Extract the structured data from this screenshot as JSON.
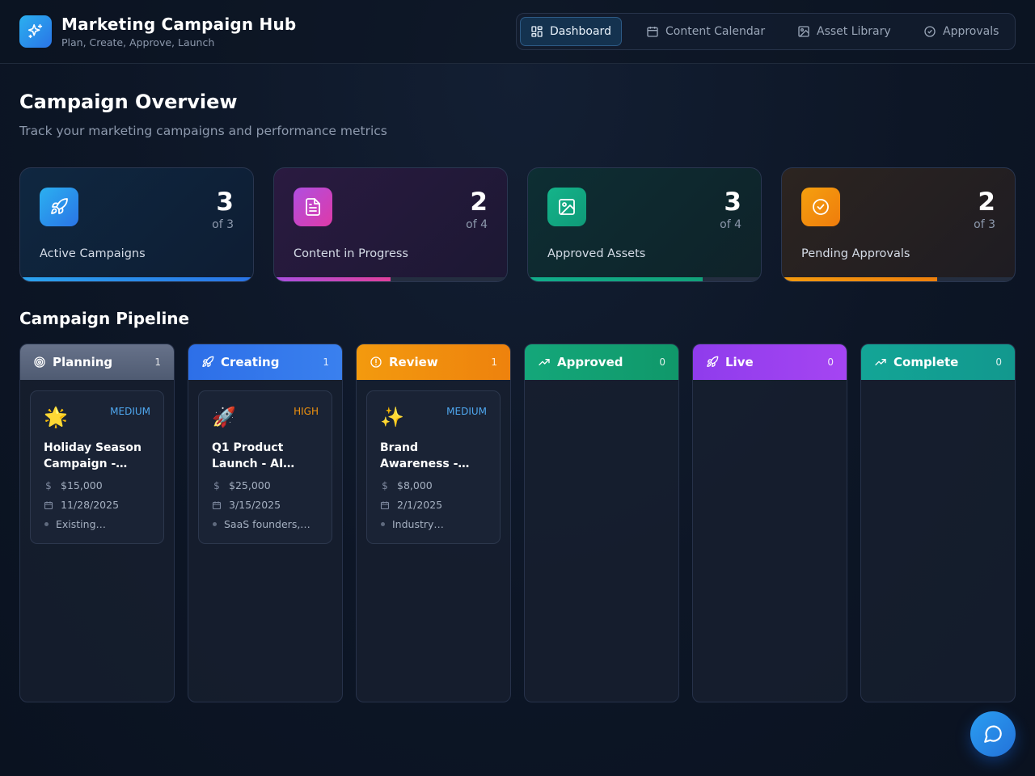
{
  "header": {
    "title": "Marketing Campaign Hub",
    "subtitle": "Plan, Create, Approve, Launch",
    "logo_icon": "sparkles-icon"
  },
  "nav": [
    {
      "label": "Dashboard",
      "icon": "dashboard-icon",
      "active": true
    },
    {
      "label": "Content Calendar",
      "icon": "calendar-icon",
      "active": false
    },
    {
      "label": "Asset Library",
      "icon": "image-icon",
      "active": false
    },
    {
      "label": "Approvals",
      "icon": "check-circle-icon",
      "active": false
    }
  ],
  "page": {
    "title": "Campaign Overview",
    "subtitle": "Track your marketing campaigns and performance metrics"
  },
  "stats": [
    {
      "value": "3",
      "of": "of 3",
      "label": "Active Campaigns",
      "icon": "rocket-icon",
      "accent": "#2a8fe8",
      "progress": 1.0
    },
    {
      "value": "2",
      "of": "of 4",
      "label": "Content in Progress",
      "icon": "document-icon",
      "accent": "#c046d6",
      "progress": 0.5
    },
    {
      "value": "3",
      "of": "of 4",
      "label": "Approved Assets",
      "icon": "image-icon",
      "accent": "#14a884",
      "progress": 0.75
    },
    {
      "value": "2",
      "of": "of 3",
      "label": "Pending Approvals",
      "icon": "check-circle-icon",
      "accent": "#f0860c",
      "progress": 0.667
    }
  ],
  "pipeline": {
    "title": "Campaign Pipeline",
    "columns": [
      {
        "name": "Planning",
        "count": "1",
        "icon": "target-icon",
        "color": "#5c6880"
      },
      {
        "name": "Creating",
        "count": "1",
        "icon": "rocket-icon",
        "color": "#2f74ea"
      },
      {
        "name": "Review",
        "count": "1",
        "icon": "alert-circle-icon",
        "color": "#f08a0e"
      },
      {
        "name": "Approved",
        "count": "0",
        "icon": "trending-up-icon",
        "color": "#14a273"
      },
      {
        "name": "Live",
        "count": "0",
        "icon": "rocket-icon",
        "color": "#9a3ff0"
      },
      {
        "name": "Complete",
        "count": "0",
        "icon": "trending-up-icon",
        "color": "#13a89a"
      }
    ],
    "cards": [
      {
        "emoji": "🌟",
        "priority": "MEDIUM",
        "priority_color": "#4fa8f0",
        "title": "Holiday Season Campaign -…",
        "budget": "$15,000",
        "date": "11/28/2025",
        "audience": "Existing…"
      },
      {
        "emoji": "🚀",
        "priority": "HIGH",
        "priority_color": "#f0920e",
        "title": "Q1 Product Launch - AI…",
        "budget": "$25,000",
        "date": "3/15/2025",
        "audience": "SaaS founders,…"
      },
      {
        "emoji": "✨",
        "priority": "MEDIUM",
        "priority_color": "#4fa8f0",
        "title": "Brand Awareness -…",
        "budget": "$8,000",
        "date": "2/1/2025",
        "audience": "Industry…"
      }
    ]
  },
  "chat": {
    "icon": "chat-icon"
  }
}
